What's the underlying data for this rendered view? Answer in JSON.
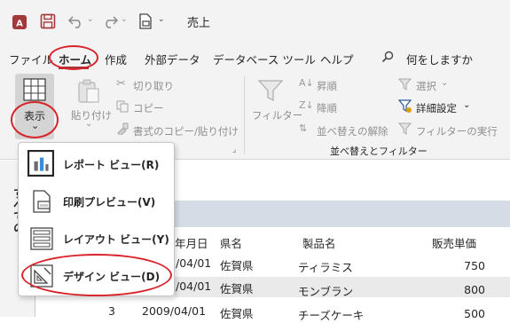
{
  "window": {
    "title": "売上"
  },
  "colors": {
    "access_brand": "#a4373a",
    "highlight_ring": "#d8232a"
  },
  "menu_tabs": [
    "ファイル",
    "ホーム",
    "作成",
    "外部データ",
    "データベース ツール",
    "ヘルプ"
  ],
  "search": {
    "label": "何をしますか"
  },
  "ribbon": {
    "view_button": {
      "label": "表示",
      "chevron": "⌄"
    },
    "clipboard": {
      "paste": "貼り付け",
      "cut": "切り取り",
      "copy": "コピー",
      "format_painter": "書式のコピー/貼り付け"
    },
    "sort_filter": {
      "filter": "フィルター",
      "ascending": "昇順",
      "descending": "降順",
      "clear_sort": "並べ替えの解除",
      "selection": "選択",
      "advanced": "詳細設定",
      "toggle_filter": "フィルターの実行",
      "group_label": "並べ替えとフィルター"
    }
  },
  "view_menu": {
    "items": [
      {
        "label": "レポート ビュー(R)",
        "icon": "report-view-icon"
      },
      {
        "label": "印刷プレビュー(V)",
        "icon": "print-preview-icon"
      },
      {
        "label": "レイアウト ビュー(Y)",
        "icon": "layout-view-icon"
      },
      {
        "label": "デザイン ビュー(D)",
        "icon": "design-view-icon"
      }
    ]
  },
  "nav_pane": {
    "text": "すべての"
  },
  "table": {
    "headers": {
      "date": "年月日",
      "prefecture": "県名",
      "product": "製品名",
      "price": "販売単価"
    },
    "rows": [
      {
        "date": "/04/01",
        "prefecture": "佐賀県",
        "product": "ティラミス",
        "price": "750"
      },
      {
        "date": "/04/01",
        "prefecture": "佐賀県",
        "product": "モンブラン",
        "price": "800"
      },
      {
        "id": "3",
        "date": "2009/04/01",
        "prefecture": "佐賀県",
        "product": "チーズケーキ",
        "price": "500"
      }
    ]
  }
}
